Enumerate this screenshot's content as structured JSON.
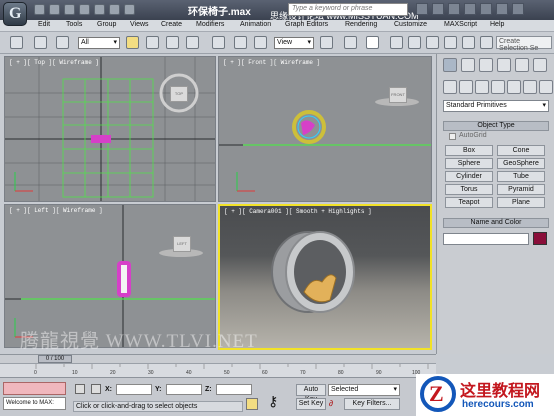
{
  "titlebar": {
    "doc_title": "环保椅子.max",
    "watermark": "思缘设计论坛 www.MISSYUAN.COM",
    "search_placeholder": "Type a keyword or phrase"
  },
  "menu": {
    "items": [
      "Edit",
      "Tools",
      "Group",
      "Views",
      "Create",
      "Modifiers",
      "Animation",
      "Graph Editors",
      "Rendering",
      "Customize",
      "MAXScript",
      "Help"
    ]
  },
  "toolbar": {
    "selection_filter": "All",
    "ref_coord": "View",
    "create_selection_set": "Create Selection Se"
  },
  "viewports": {
    "top": "[ + ][ Top ][ Wireframe ]",
    "front": "[ + ][ Front ][ Wireframe ]",
    "left": "[ + ][ Left ][ Wireframe ]",
    "camera": "[ + ][ Camera001 ][ Smooth + Highlights ]",
    "cube_top": "TOP",
    "cube_front": "FRONT",
    "cube_left": "LEFT"
  },
  "command_panel": {
    "category_dropdown": "Standard Primitives",
    "object_type_title": "Object Type",
    "autogrid_label": "AutoGrid",
    "primitives": [
      "Box",
      "Cone",
      "Sphere",
      "GeoSphere",
      "Cylinder",
      "Tube",
      "Torus",
      "Pyramid",
      "Teapot",
      "Plane"
    ],
    "name_color_title": "Name and Color",
    "object_color": "#8a0f3a"
  },
  "timeline": {
    "frame_display": "0 / 100",
    "ticks": [
      "0",
      "10",
      "20",
      "30",
      "40",
      "50",
      "60",
      "70",
      "80",
      "90",
      "100"
    ]
  },
  "status": {
    "welcome": "Welcome to MAX:",
    "prompt": "Click or click-and-drag to select objects",
    "x_label": "X:",
    "y_label": "Y:",
    "z_label": "Z:",
    "auto_key": "Auto Key",
    "set_key": "Set Key",
    "selected": "Selected",
    "key_filters": "Key Filters..."
  },
  "watermarks": {
    "site_cn": "这里教程网",
    "site_url": "herecours.com",
    "viewport_watermark": "腾龍視覺 WWW.TLVI.NET"
  }
}
